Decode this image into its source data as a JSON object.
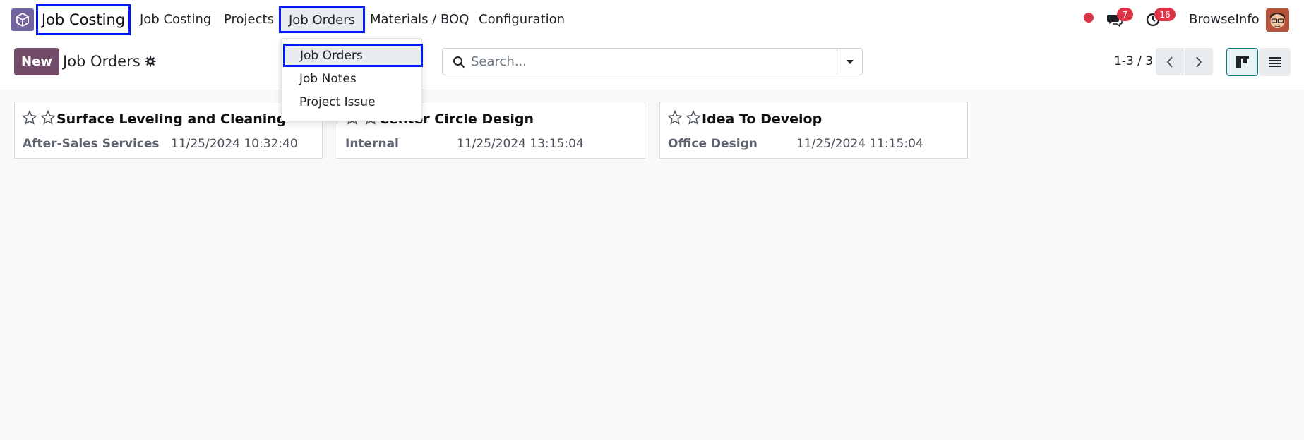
{
  "navbar": {
    "app_name": "Job Costing",
    "menu": [
      {
        "label": "Job Costing"
      },
      {
        "label": "Projects"
      },
      {
        "label": "Job Orders"
      },
      {
        "label": "Materials / BOQ"
      },
      {
        "label": "Configuration"
      }
    ],
    "messages_badge": "7",
    "activities_badge": "16",
    "user_name": "BrowseInfo",
    "status_dot_color": "#dc3545"
  },
  "dropdown": {
    "items": [
      {
        "label": "Job Orders"
      },
      {
        "label": "Job Notes"
      },
      {
        "label": "Project Issue"
      }
    ]
  },
  "control_panel": {
    "new_label": "New",
    "title": "Job Orders",
    "search_placeholder": "Search...",
    "pager": "1-3 / 3",
    "accent_color": "#714b67"
  },
  "cards": [
    {
      "title": "Surface Leveling and Cleaning",
      "project": "After-Sales Services",
      "date": "11/25/2024 10:32:40"
    },
    {
      "title": "Center Circle Design",
      "project": "Internal",
      "date": "11/25/2024 13:15:04"
    },
    {
      "title": "Idea To Develop",
      "project": "Office Design",
      "date": "11/25/2024 11:15:04"
    }
  ]
}
